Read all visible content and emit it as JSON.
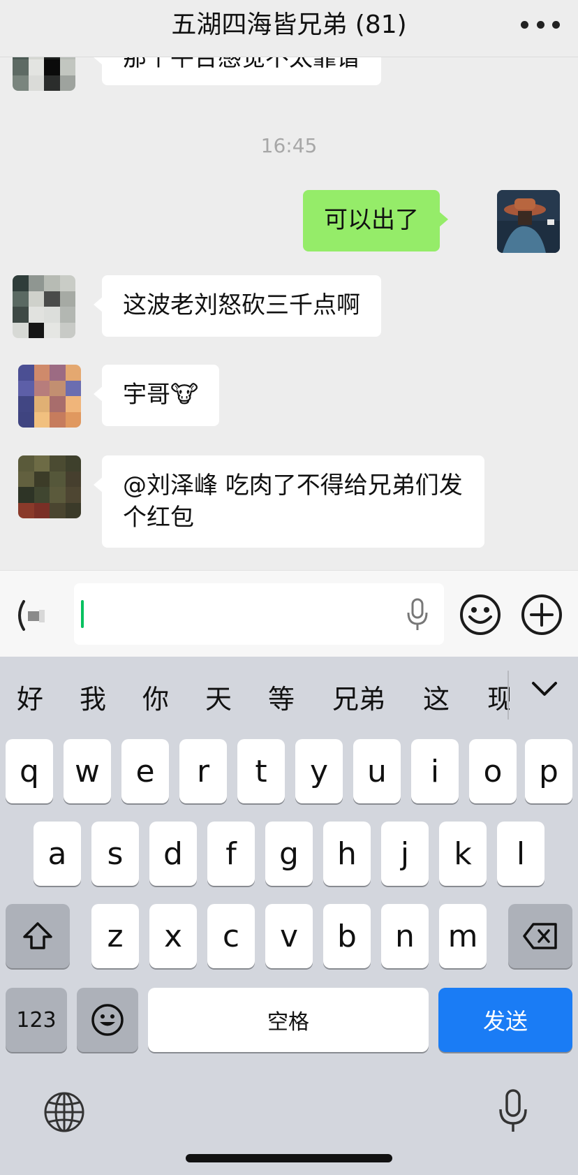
{
  "header": {
    "title": "五湖四海皆兄弟 (81)",
    "more_icon": "more-dots-icon"
  },
  "messages": [
    {
      "side": "left",
      "text": "那个平台感觉不太靠谱",
      "avatar_colors": [
        "#3a4a45",
        "#c9cbc6",
        "#6c7770",
        "#a4a9a4",
        "#4b5a54",
        "#d5d7d2",
        "#1c1f1e",
        "#b7bcb6",
        "#5e6a64",
        "#e3e4e1",
        "#0b0b0b",
        "#c2c6c0",
        "#7a857e",
        "#dadbd8",
        "#2b2d2c",
        "#9ea39e"
      ]
    },
    {
      "type": "time",
      "text": "16:45"
    },
    {
      "side": "right",
      "text": "可以出了"
    },
    {
      "side": "left",
      "text": "这波老刘怒砍三千点啊",
      "avatar_colors": [
        "#2f3d3a",
        "#8f9691",
        "#b7bbb4",
        "#c9ccc6",
        "#5a6962",
        "#cfd1cb",
        "#4a4b4a",
        "#a6aaa4",
        "#3e4945",
        "#e1e2df",
        "#dcdedb",
        "#b3b7b2",
        "#d7d9d5",
        "#161616",
        "#e5e6e3",
        "#c8cac6"
      ]
    },
    {
      "side": "left",
      "text": "宇哥🐮",
      "avatar_colors": [
        "#4b4f93",
        "#cf8a6b",
        "#9c6b83",
        "#e4a870",
        "#5d5fa8",
        "#b77d7c",
        "#c28f71",
        "#6b6db0",
        "#414683",
        "#e0b074",
        "#a86d6c",
        "#f0b57a",
        "#3f4480",
        "#f1c07f",
        "#c67c5d",
        "#e0985f"
      ]
    },
    {
      "side": "left",
      "text": "@刘泽峰 吃肉了不得给兄弟们发个红包",
      "avatar_colors": [
        "#5a5a3a",
        "#6d6b45",
        "#4b4b32",
        "#3e402c",
        "#62603f",
        "#3c3c28",
        "#55573a",
        "#463f2e",
        "#2e3426",
        "#404630",
        "#5b5a3c",
        "#4e4632",
        "#8a3a2a",
        "#7a2f26",
        "#4a4530",
        "#3b3a29"
      ]
    }
  ],
  "input": {
    "placeholder": "",
    "voice_icon": "voice-toggle-icon",
    "mic_icon": "microphone-icon",
    "emoji_icon": "emoji-icon",
    "plus_icon": "plus-icon"
  },
  "candidates": [
    "好",
    "我",
    "你",
    "天",
    "等",
    "兄弟",
    "这",
    "现"
  ],
  "keys": {
    "row1": [
      "q",
      "w",
      "e",
      "r",
      "t",
      "y",
      "u",
      "i",
      "o",
      "p"
    ],
    "row2": [
      "a",
      "s",
      "d",
      "f",
      "g",
      "h",
      "j",
      "k",
      "l"
    ],
    "row3": [
      "z",
      "x",
      "c",
      "v",
      "b",
      "n",
      "m"
    ],
    "numbers": "123",
    "space": "空格",
    "send": "发送"
  }
}
